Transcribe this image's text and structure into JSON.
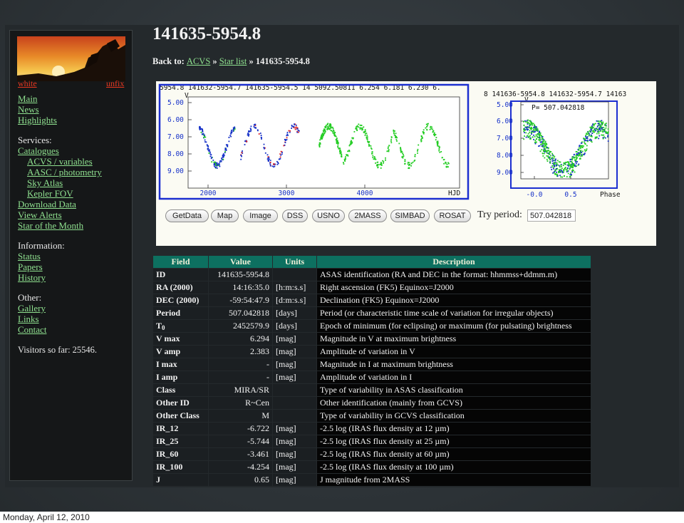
{
  "page": {
    "title": "141635-5954.8",
    "breadcrumb": {
      "prefix": "Back to:",
      "links": [
        "ACVS",
        "Star list"
      ],
      "separator": "»",
      "current": "141635-5954.8"
    }
  },
  "sidebar": {
    "skin_links": [
      "white",
      "unfix"
    ],
    "groups": [
      {
        "heading": "",
        "items": [
          {
            "label": "Main"
          },
          {
            "label": "News"
          },
          {
            "label": "Highlights"
          }
        ]
      },
      {
        "heading": "Services:",
        "items": [
          {
            "label": "Catalogues"
          },
          {
            "label": "ACVS / variables",
            "sub": true
          },
          {
            "label": "AASC / photometry",
            "sub": true
          },
          {
            "label": "Sky Atlas",
            "sub": true
          },
          {
            "label": "Kepler FOV",
            "sub": true
          },
          {
            "label": "Download Data"
          },
          {
            "label": "View Alerts"
          },
          {
            "label": "Star of the Month"
          }
        ]
      },
      {
        "heading": "Information:",
        "items": [
          {
            "label": "Status"
          },
          {
            "label": "Papers"
          },
          {
            "label": "History"
          }
        ]
      },
      {
        "heading": "Other:",
        "items": [
          {
            "label": "Gallery"
          },
          {
            "label": "Links"
          },
          {
            "label": "Contact"
          }
        ]
      }
    ],
    "visitors": "Visitors so far: 25546."
  },
  "lightcurve": {
    "header": "5954.8 141632-5954.7 141635-5954.5 14   5092.50811  6.254  6.181  6.230  6.",
    "y_axis_letter": "V",
    "y_ticks": [
      "5.00",
      "6.00",
      "7.00",
      "8.00",
      "9.00"
    ],
    "x_ticks": [
      "2000",
      "3000",
      "4000"
    ],
    "x_label": "HJD",
    "colors": {
      "frame": "#1c2fd0",
      "series_blue": "#1530c8",
      "series_green": "#22cc22",
      "series_red": "#e02020"
    }
  },
  "phased": {
    "header": "8 141636-5954.8 141632-5954.7 14163",
    "y_axis_letter": "V",
    "period_label": "P= 507.042818",
    "y_ticks": [
      "5.00",
      "6.00",
      "7.00",
      "8.00",
      "9.00"
    ],
    "x_ticks": [
      "-0.0",
      "0.5"
    ],
    "x_label": "Phase"
  },
  "controls": {
    "buttons": [
      "GetData",
      "Map",
      "Image",
      "DSS",
      "USNO",
      "2MASS",
      "SIMBAD",
      "ROSAT"
    ],
    "try_period_label": "Try period:",
    "try_period_value": "507.042818"
  },
  "table": {
    "headers": [
      "Field",
      "Value",
      "Units",
      "Description"
    ],
    "rows": [
      {
        "field": "ID",
        "value": "141635-5954.8",
        "units": "",
        "description": "ASAS identification (RA and DEC in the format: hhmmss+ddmm.m)"
      },
      {
        "field": "RA (2000)",
        "value": "14:16:35.0",
        "units": "[h:m:s.s]",
        "description": "Right ascension (FK5) Equinox=J2000"
      },
      {
        "field": "DEC (2000)",
        "value": "-59:54:47.9",
        "units": "[d:m:s.s]",
        "description": "Declination (FK5) Equinox=J2000"
      },
      {
        "field": "Period",
        "value": "507.042818",
        "units": "[days]",
        "description": "Period (or characteristic time scale of variation for irregular objects)"
      },
      {
        "field": "T",
        "field_sub": "0",
        "value": "2452579.9",
        "units": "[days]",
        "description": "Epoch of minimum (for eclipsing) or maximum (for pulsating) brightness"
      },
      {
        "field": "V max",
        "value": "6.294",
        "units": "[mag]",
        "description": "Magnitude in V at maximum brightness"
      },
      {
        "field": "V amp",
        "value": "2.383",
        "units": "[mag]",
        "description": "Amplitude of variation in V"
      },
      {
        "field": "I max",
        "value": "-",
        "units": "[mag]",
        "description": "Magnitude in I at maximum brightness"
      },
      {
        "field": "I amp",
        "value": "-",
        "units": "[mag]",
        "description": "Amplitude of variation in I"
      },
      {
        "field": "Class",
        "value": "MIRA/SR",
        "units": "",
        "description": "Type of variability in ASAS classification"
      },
      {
        "field": "Other ID",
        "value": "R~Cen",
        "units": "",
        "description": "Other identification (mainly from GCVS)"
      },
      {
        "field": "Other Class",
        "value": "M",
        "units": "",
        "description": "Type of variability in GCVS classification"
      },
      {
        "field": "IR_12",
        "value": "-6.722",
        "units": "[mag]",
        "description": "-2.5 log (IRAS flux density at 12 µm)"
      },
      {
        "field": "IR_25",
        "value": "-5.744",
        "units": "[mag]",
        "description": "-2.5 log (IRAS flux density at 25 µm)"
      },
      {
        "field": "IR_60",
        "value": "-3.461",
        "units": "[mag]",
        "description": "-2.5 log (IRAS flux density at 60 µm)"
      },
      {
        "field": "IR_100",
        "value": "-4.254",
        "units": "[mag]",
        "description": "-2.5 log (IRAS flux density at 100 µm)"
      },
      {
        "field": "J",
        "value": "0.65",
        "units": "[mag]",
        "description": "J magnitude from 2MASS"
      }
    ]
  },
  "footer": {
    "date": "Monday, April 12, 2010"
  }
}
